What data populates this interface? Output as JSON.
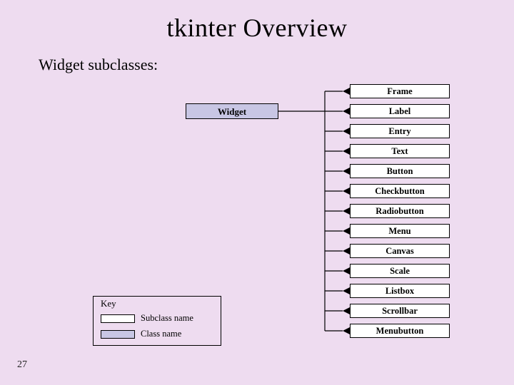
{
  "title": "tkinter Overview",
  "subheading": "Widget subclasses:",
  "parentClass": "Widget",
  "subclasses": [
    "Frame",
    "Label",
    "Entry",
    "Text",
    "Button",
    "Checkbutton",
    "Radiobutton",
    "Menu",
    "Canvas",
    "Scale",
    "Listbox",
    "Scrollbar",
    "Menubutton"
  ],
  "key": {
    "title": "Key",
    "subclassLabel": "Subclass name",
    "classLabel": "Class name",
    "subclassSwatchColor": "#ffffff",
    "classSwatchColor": "#c8c6e4"
  },
  "pageNumber": "27",
  "layout": {
    "subclassBoxLeft": 490,
    "subclassBoxWidth": 140,
    "subclassBoxHeight": 20,
    "subclassStartTop": 118,
    "subclassSpacing": 28,
    "parentBoxRightX": 390,
    "parentBoxCenterY": 156,
    "trunkX": 455,
    "branchStartX": 480
  }
}
